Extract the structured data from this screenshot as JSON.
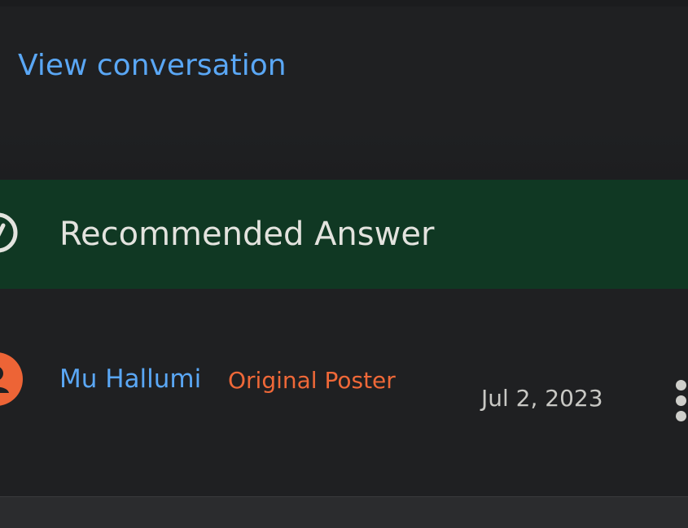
{
  "conversation": {
    "view_link": "View conversation"
  },
  "recommended": {
    "label": "Recommended Answer",
    "icon": "check-circle-icon"
  },
  "post": {
    "author": "Mu Hallumi",
    "badge": "Original Poster",
    "date": "Jul 2, 2023",
    "avatar_icon": "person-icon",
    "menu_icon": "more-vert-icon"
  },
  "colors": {
    "link": "#5aa7f5",
    "banner_bg": "#103823",
    "op_badge": "#ef6838",
    "avatar_bg": "#ed6436",
    "page_bg": "#1f2022"
  }
}
